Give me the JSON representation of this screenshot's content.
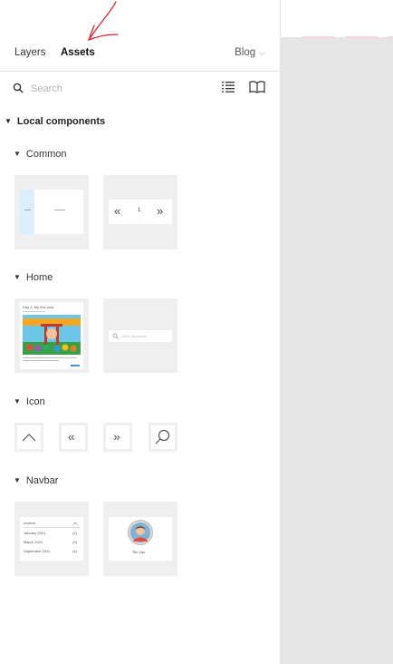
{
  "tabs": {
    "layers": "Layers",
    "assets": "Assets"
  },
  "page_selector": {
    "label": "Blog"
  },
  "search": {
    "placeholder": "Search"
  },
  "local_components": {
    "label": "Local components"
  },
  "sections": {
    "common": "Common",
    "home": "Home",
    "icon": "Icon",
    "navbar": "Navbar"
  },
  "thumbnails": {
    "pagination": {
      "page_number": "1"
    },
    "post_card": {
      "title": "Day 1: My first post"
    },
    "search_box": {
      "placeholder": "Other keywords"
    },
    "archive": {
      "title": "Archive",
      "rows": [
        {
          "month": "January 2021",
          "count": "(1)"
        },
        {
          "month": "March 2021",
          "count": "(3)"
        },
        {
          "month": "September 2021",
          "count": "(4)"
        }
      ]
    },
    "profile": {
      "name": "Tim Yau"
    }
  },
  "colors": {
    "annotation": "#e0202a",
    "canvas": "#e5e5e5",
    "thumb_bg": "#efefef"
  }
}
